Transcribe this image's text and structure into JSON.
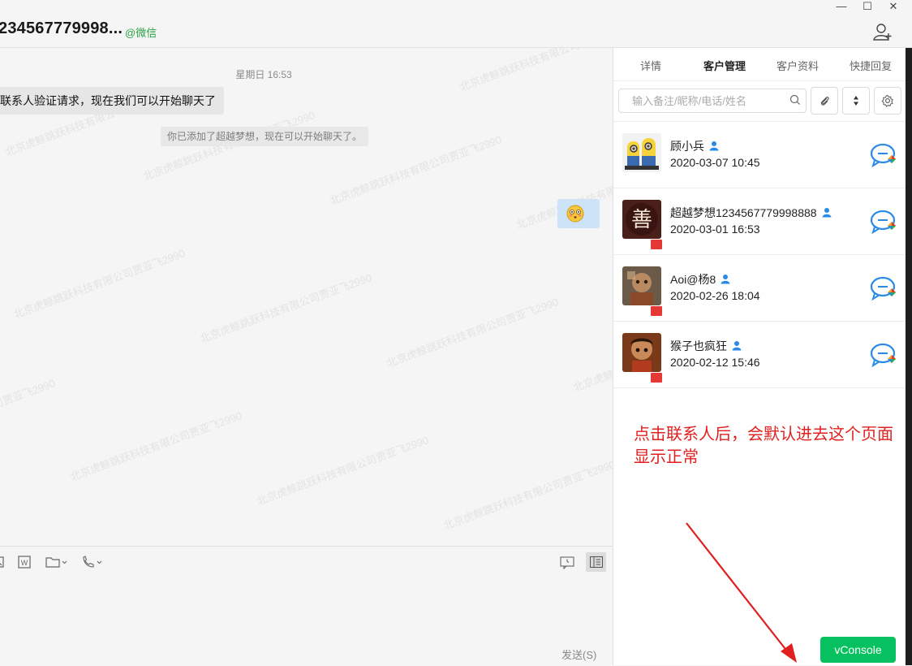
{
  "header": {
    "chat_name": "234567779998...",
    "source": "@微信",
    "minimize": "—",
    "maximize": "☐",
    "close": "✕"
  },
  "chat": {
    "time_divider": "星期日 16:53",
    "incoming_message": "联系人验证请求，现在我们可以开始聊天了",
    "system_notice": "你已添加了超越梦想，现在可以开始聊天了。",
    "watermark": "北京虎鲸跳跃科技有限公司贾亚飞2990"
  },
  "composer": {
    "send_label": "发送(S)"
  },
  "right_panel": {
    "tabs": [
      {
        "label": "详情",
        "active": false
      },
      {
        "label": "客户管理",
        "active": true
      },
      {
        "label": "客户资料",
        "active": false
      },
      {
        "label": "快捷回复",
        "active": false
      }
    ],
    "search_placeholder": "输入备注/昵称/电话/姓名",
    "contacts": [
      {
        "name": "顾小兵",
        "time": "2020-03-07 10:45",
        "flag": false
      },
      {
        "name": "超越梦想1234567779998888",
        "time": "2020-03-01 16:53",
        "flag": true
      },
      {
        "name": "Aoi@杨8",
        "time": "2020-02-26 18:04",
        "flag": true
      },
      {
        "name": "猴子也疯狂",
        "time": "2020-02-12 15:46",
        "flag": true
      }
    ]
  },
  "annotation": {
    "line1": "点击联系人后，会默认进去这个页面",
    "line2": "显示正常"
  },
  "vconsole_label": "vConsole",
  "colors": {
    "accent_green": "#07c160",
    "source_green": "#2ba245",
    "annotation_red": "#e02020",
    "icon_blue": "#2a8ae6"
  }
}
